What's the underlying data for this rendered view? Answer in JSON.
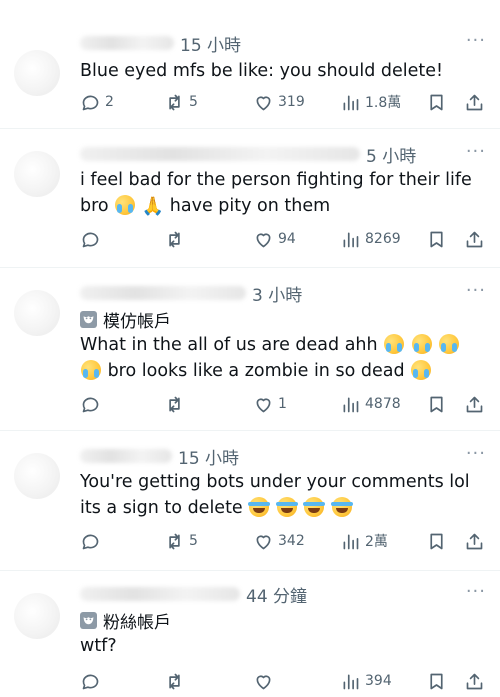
{
  "replies": [
    {
      "time": "15 小時",
      "badge": null,
      "lines": [
        "Blue eyed mfs be like: you should delete!"
      ],
      "stats": {
        "replies": "2",
        "reposts": "5",
        "likes": "319",
        "views": "1.8萬"
      }
    },
    {
      "time": "5 小時",
      "badge": null,
      "lines": [
        "i feel bad for the person fighting for their life",
        "bro",
        "have pity on them"
      ],
      "stats": {
        "replies": "",
        "reposts": "",
        "likes": "94",
        "views": "8269"
      }
    },
    {
      "time": "3 小時",
      "badge": "模仿帳戶",
      "lines": [
        "What in the all of us are dead ahh",
        "bro looks like a zombie in so dead"
      ],
      "stats": {
        "replies": "",
        "reposts": "",
        "likes": "1",
        "views": "4878"
      }
    },
    {
      "time": "15 小時",
      "badge": null,
      "lines": [
        "You're getting bots under your comments lol",
        "its a sign to delete"
      ],
      "stats": {
        "replies": "",
        "reposts": "5",
        "likes": "342",
        "views": "2萬"
      }
    },
    {
      "time": "44 分鐘",
      "badge": "粉絲帳戶",
      "lines": [
        "wtf?"
      ],
      "stats": {
        "replies": "",
        "reposts": "",
        "likes": "",
        "views": "394"
      }
    }
  ],
  "icons": {
    "reply": "reply-icon",
    "repost": "repost-icon",
    "like": "like-icon",
    "views": "views-icon",
    "bookmark": "bookmark-icon",
    "share": "share-icon",
    "more": "more-icon",
    "badge": "mask-icon"
  },
  "colors": {
    "text": "#0f1419",
    "muted": "#536471",
    "divider": "#eff3f4"
  }
}
